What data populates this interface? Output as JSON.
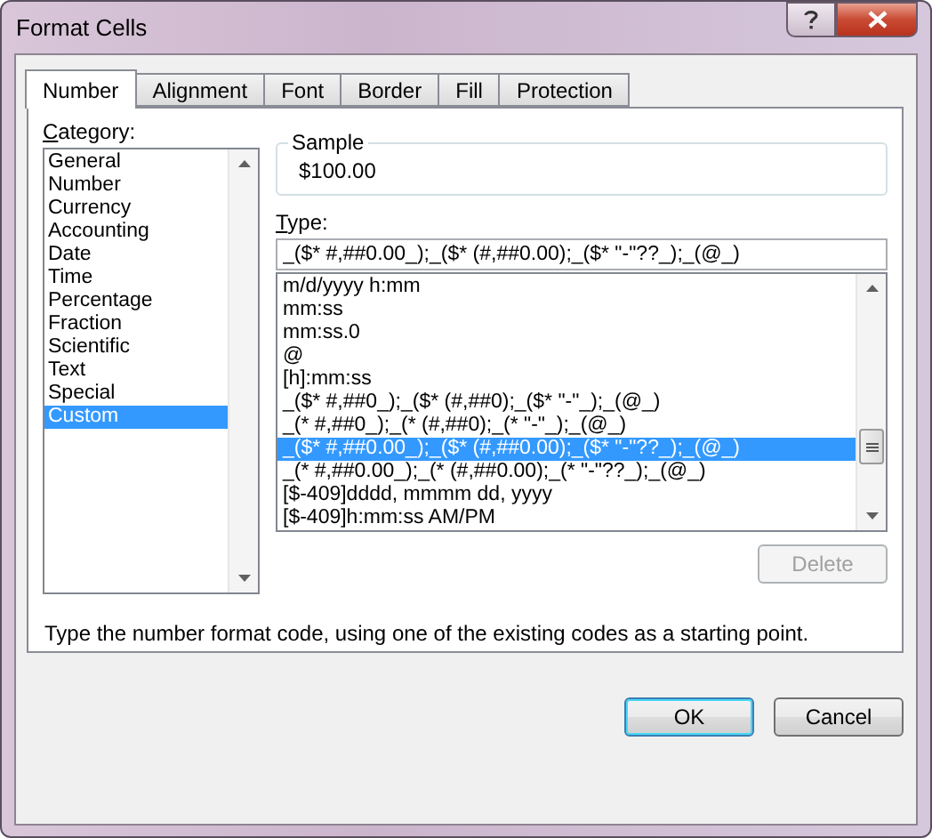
{
  "window": {
    "title": "Format Cells"
  },
  "tabs": [
    {
      "label": "Number",
      "selected": true
    },
    {
      "label": "Alignment",
      "selected": false
    },
    {
      "label": "Font",
      "selected": false
    },
    {
      "label": "Border",
      "selected": false
    },
    {
      "label": "Fill",
      "selected": false
    },
    {
      "label": "Protection",
      "selected": false
    }
  ],
  "category": {
    "label": "Category:",
    "items": [
      {
        "label": "General",
        "selected": false
      },
      {
        "label": "Number",
        "selected": false
      },
      {
        "label": "Currency",
        "selected": false
      },
      {
        "label": "Accounting",
        "selected": false
      },
      {
        "label": "Date",
        "selected": false
      },
      {
        "label": "Time",
        "selected": false
      },
      {
        "label": "Percentage",
        "selected": false
      },
      {
        "label": "Fraction",
        "selected": false
      },
      {
        "label": "Scientific",
        "selected": false
      },
      {
        "label": "Text",
        "selected": false
      },
      {
        "label": "Special",
        "selected": false
      },
      {
        "label": "Custom",
        "selected": true
      }
    ]
  },
  "sample": {
    "label": "Sample",
    "value": "$100.00"
  },
  "type": {
    "label": "Type:",
    "value": "_($* #,##0.00_);_($* (#,##0.00);_($* \"-\"??_);_(@_)",
    "items": [
      {
        "label": "m/d/yyyy h:mm",
        "selected": false
      },
      {
        "label": "mm:ss",
        "selected": false
      },
      {
        "label": "mm:ss.0",
        "selected": false
      },
      {
        "label": "@",
        "selected": false
      },
      {
        "label": "[h]:mm:ss",
        "selected": false
      },
      {
        "label": "_($* #,##0_);_($* (#,##0);_($* \"-\"_);_(@_)",
        "selected": false
      },
      {
        "label": "_(* #,##0_);_(* (#,##0);_(* \"-\"_);_(@_)",
        "selected": false
      },
      {
        "label": "_($* #,##0.00_);_($* (#,##0.00);_($* \"-\"??_);_(@_)",
        "selected": true
      },
      {
        "label": "_(* #,##0.00_);_(* (#,##0.00);_(* \"-\"??_);_(@_)",
        "selected": false
      },
      {
        "label": "[$-409]dddd, mmmm dd, yyyy",
        "selected": false
      },
      {
        "label": "[$-409]h:mm:ss AM/PM",
        "selected": false
      }
    ]
  },
  "delete_button": {
    "label": "Delete",
    "disabled": true
  },
  "description": "Type the number format code, using one of the existing codes as a starting point.",
  "buttons": [
    {
      "label": "OK",
      "kind": "default"
    },
    {
      "label": "Cancel",
      "kind": "normal"
    }
  ]
}
